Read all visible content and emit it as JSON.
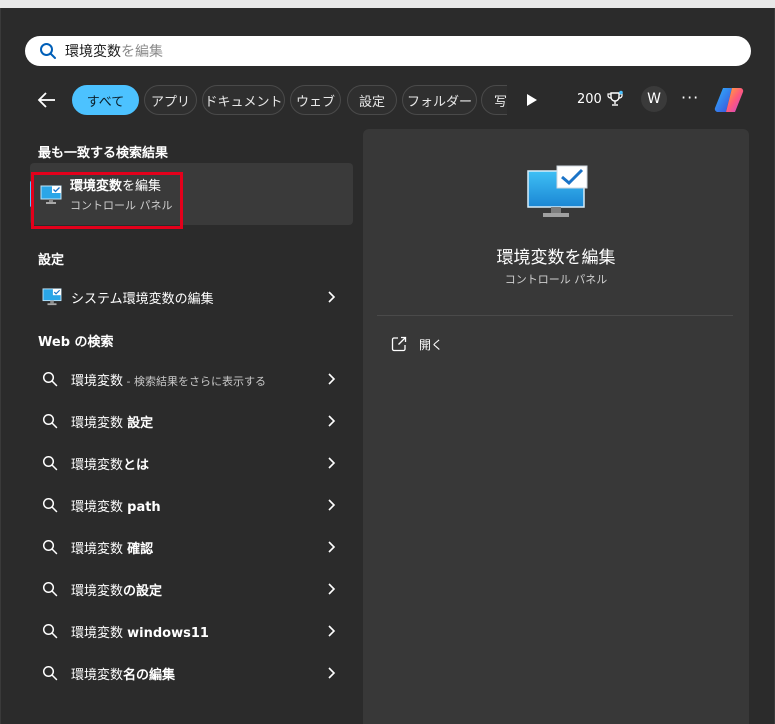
{
  "search": {
    "typed": "環境変数",
    "hint": "を編集"
  },
  "filters": {
    "chips": [
      "すべて",
      "アプリ",
      "ドキュメント",
      "ウェブ",
      "設定",
      "フォルダー",
      "写"
    ],
    "score": "200",
    "avatar": "W",
    "more": "···"
  },
  "best_match": {
    "section": "最も一致する検索結果",
    "title_bold": "環境変数",
    "title_rest": "を編集",
    "subtitle": "コントロール パネル"
  },
  "settings": {
    "section": "設定",
    "item": "システム環境変数の編集"
  },
  "web": {
    "section": "Web の検索",
    "items": [
      {
        "normal": "環境変数",
        "bold": "",
        "sub": " - 検索結果をさらに表示する"
      },
      {
        "normal": "環境変数 ",
        "bold": "設定",
        "sub": ""
      },
      {
        "normal": "環境変数",
        "bold": "とは",
        "sub": ""
      },
      {
        "normal": "環境変数 ",
        "bold": "path",
        "sub": ""
      },
      {
        "normal": "環境変数 ",
        "bold": "確認",
        "sub": ""
      },
      {
        "normal": "環境変数",
        "bold": "の設定",
        "sub": ""
      },
      {
        "normal": "環境変数 ",
        "bold": "windows11",
        "sub": ""
      },
      {
        "normal": "環境変数",
        "bold": "名の編集",
        "sub": ""
      }
    ]
  },
  "preview": {
    "title": "環境変数を編集",
    "subtitle": "コントロール パネル",
    "action": "開く"
  },
  "colors": {
    "accent": "#4cc2ff",
    "highlight_box": "#e3001b",
    "panel": "#383838",
    "background": "#2b2b2b"
  },
  "icons": [
    "search-icon",
    "back-arrow-icon",
    "play-icon",
    "trophy-icon",
    "copilot-icon",
    "monitor-check-icon",
    "chevron-right-icon",
    "open-external-icon"
  ]
}
